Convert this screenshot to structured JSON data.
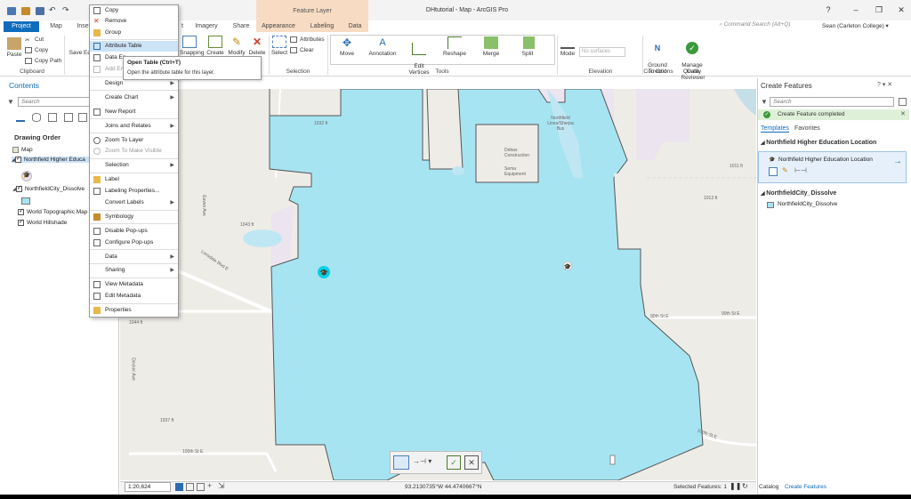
{
  "window": {
    "title": "DHtutorial - Map - ArcGIS Pro",
    "context_tab_group": "Feature Layer"
  },
  "header": {
    "search_placeholder": "Command Search (Alt+Q)",
    "user": "Sean (Carleton College) ▾"
  },
  "tabs": [
    "Project",
    "Map",
    "Inse",
    "t",
    "Imagery",
    "Share",
    "Appearance",
    "Labeling",
    "Data"
  ],
  "ribbon": {
    "clipboard": {
      "paste": "Paste",
      "cut": "Cut",
      "copy": "Copy",
      "copy_path": "Copy Path",
      "label": "Clipboard"
    },
    "save": "Save",
    "edit_partial": "Ed",
    "snapping": "Snapping",
    "create": "Create",
    "modify": "Modify",
    "delete": "Delete",
    "selection": {
      "select": "Select",
      "attributes": "Attributes",
      "clear": "Clear",
      "label": "Selection"
    },
    "tools": {
      "move": "Move",
      "annotation": "Annotation",
      "edit_vertices": "Edit\nVertices",
      "reshape": "Reshape",
      "merge": "Merge",
      "split": "Split",
      "label": "Tools"
    },
    "elevation": {
      "mode": "Mode",
      "no_surfaces": "No surfaces",
      "label": "Elevation"
    },
    "corrections": {
      "ground_to_grid": "Ground\nTo Grid",
      "label": "Corrections"
    },
    "data_reviewer": {
      "manage_quality": "Manage\nQuality",
      "label": "Data Reviewer"
    }
  },
  "contents": {
    "title": "Contents",
    "search_placeholder": "Search",
    "drawing_order": "Drawing Order",
    "layers": [
      "Map",
      "Northfield Higher Educa",
      "NorthfieldCity_Dissolve",
      "World Topographic Map",
      "World Hillshade"
    ]
  },
  "context_menu": [
    {
      "label": "Copy"
    },
    {
      "label": "Remove"
    },
    {
      "label": "Group"
    },
    {
      "label": "Attribute Table",
      "highlight": true
    },
    {
      "label": "Data En"
    },
    {
      "label": "Add Er",
      "disabled": true
    },
    {
      "label": "Design",
      "submenu": true
    },
    {
      "label": "Create Chart",
      "submenu": true
    },
    {
      "label": "New Report"
    },
    {
      "label": "Joins and Relates",
      "submenu": true
    },
    {
      "label": "Zoom To Layer"
    },
    {
      "label": "Zoom To Make Visible",
      "disabled": true
    },
    {
      "label": "Selection",
      "submenu": true
    },
    {
      "label": "Label"
    },
    {
      "label": "Labeling Properties..."
    },
    {
      "label": "Convert Labels",
      "submenu": true
    },
    {
      "label": "Symbology"
    },
    {
      "label": "Disable Pop-ups"
    },
    {
      "label": "Configure Pop-ups"
    },
    {
      "label": "Data",
      "submenu": true
    },
    {
      "label": "Sharing",
      "submenu": true
    },
    {
      "label": "View Metadata"
    },
    {
      "label": "Edit Metadata"
    },
    {
      "label": "Properties"
    }
  ],
  "tooltip": {
    "title": "Open Table (Ctrl+T)",
    "body": "Open the attribute table for this layer."
  },
  "map_labels": {
    "northfield_lines": "Northfield\nLines/Sherpa\nBus",
    "sema": "Sema\nEquipment",
    "debas": "Debas\nConstruction",
    "l90th_e1": "90th St E",
    "l90th_e2": "90th St E",
    "l100th_w": "100th St E",
    "l100th_e": "100th St E",
    "r1032": "1032 ft",
    "r1013": "1013 ft",
    "r1011": "1011 ft",
    "r1044": "1044 ft",
    "r1043": "1043 ft",
    "r1037": "1037 ft",
    "lonsdale": "Lonsdale Blvd E",
    "eaves": "Eaves Ave",
    "decker": "Decker Ave"
  },
  "create_features": {
    "title": "Create Features",
    "search_placeholder": "Search",
    "status": "Create Feature completed",
    "tab_templates": "Templates",
    "tab_favorites": "Favorites",
    "group1": "Northfield Higher Education Location",
    "item1": "Northfield Higher Education Location",
    "group2": "NorthfieldCity_Dissolve",
    "item2": "NorthfieldCity_Dissolve"
  },
  "status_bar": {
    "scale": "1:20,624",
    "coords": "93.2130735°W 44.4740667°N",
    "selected": "Selected Features: 1",
    "tab_catalog": "Catalog",
    "tab_create": "Create Features"
  },
  "colors": {
    "accent": "#0f6cbd",
    "city_fill": "#a7e4f2",
    "map_bg": "#eeece6",
    "feature_point": "#00d2e6"
  }
}
